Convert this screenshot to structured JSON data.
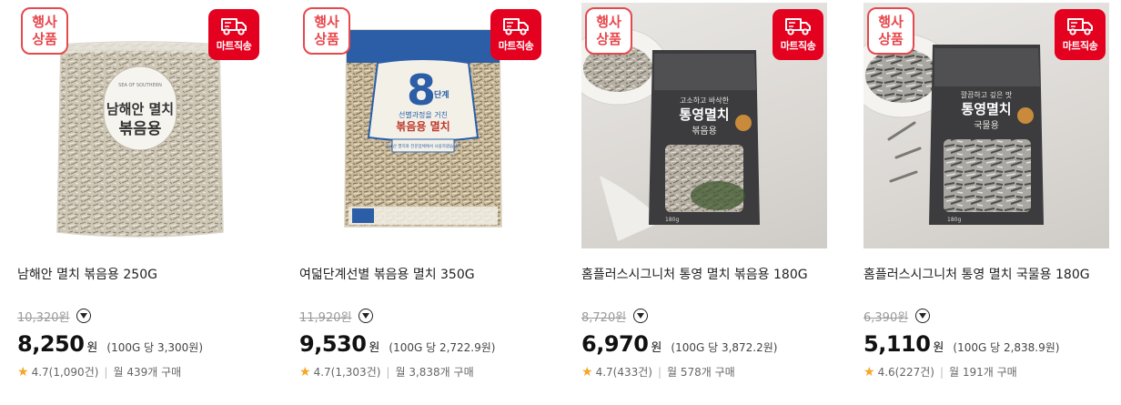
{
  "common": {
    "event_badge_line1": "행사",
    "event_badge_line2": "상품",
    "delivery_badge": "마트직송",
    "currency": "원",
    "colors": {
      "accent_red": "#e4001f",
      "star": "#f5a623"
    }
  },
  "products": [
    {
      "title": "남해안 멸치 볶음용 250G",
      "original_price": "10,320",
      "price": "8,250",
      "unit_price": "(100G 당 3,300원)",
      "rating": "4.7",
      "review_count": "(1,090건)",
      "monthly_purchases": "월 439개 구매",
      "package_text": {
        "brand_small": "SEA OF SOUTHERN",
        "name1": "남해안 멸치",
        "name2": "볶음용"
      }
    },
    {
      "title": "여덟단계선별 볶음용 멸치 350G",
      "original_price": "11,920",
      "price": "9,530",
      "unit_price": "(100G 당 2,722.9원)",
      "rating": "4.7",
      "review_count": "(1,303건)",
      "monthly_purchases": "월 3,838개 구매",
      "package_text": {
        "big": "8",
        "step": "단계",
        "line1": "선별과정을 거친",
        "line2": "볶음용 멸치",
        "note": "국내산 멸치와 전문업체에서 사용하였습니다"
      }
    },
    {
      "title": "홈플러스시그니처 통영 멸치 볶음용 180G",
      "original_price": "8,720",
      "price": "6,970",
      "unit_price": "(100G 당 3,872.2원)",
      "rating": "4.7",
      "review_count": "(433건)",
      "monthly_purchases": "월 578개 구매",
      "package_text": {
        "tag": "고소하고 바삭한",
        "name": "통영멸치",
        "type": "볶음용",
        "weight": "180g"
      }
    },
    {
      "title": "홈플러스시그니처 통영 멸치 국물용 180G",
      "original_price": "6,390",
      "price": "5,110",
      "unit_price": "(100G 당 2,838.9원)",
      "rating": "4.6",
      "review_count": "(227건)",
      "monthly_purchases": "월 191개 구매",
      "package_text": {
        "tag": "깔끔하고 깊은 맛",
        "name": "통영멸치",
        "type": "국물용",
        "weight": "180g"
      }
    }
  ]
}
